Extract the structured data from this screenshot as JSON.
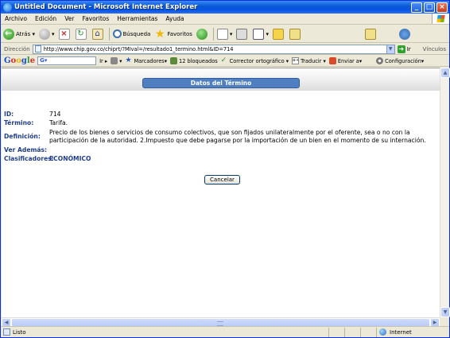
{
  "window": {
    "title": "Untitled Document - Microsoft Internet Explorer",
    "min": "_",
    "max": "□",
    "close": "×"
  },
  "menu": [
    "Archivo",
    "Edición",
    "Ver",
    "Favoritos",
    "Herramientas",
    "Ayuda"
  ],
  "toolbar": {
    "back": "Atrás",
    "search": "Búsqueda",
    "favorites": "Favoritos"
  },
  "address": {
    "label": "Dirección",
    "url": "http://www.chip.gov.co/chiprt/?MIval=/resultado1_termino.html&ID=714",
    "go": "Ir",
    "links": "Vínculos"
  },
  "google": {
    "search_prefix": "G▾",
    "go": "Ir ▸",
    "bookmarks": "Marcadores▾",
    "blocked": "12 bloqueados",
    "spell": "Corrector ortográfico ▾",
    "translate": "Traducir ▾",
    "send": "Enviar a▾",
    "settings": "Configuración▾"
  },
  "page": {
    "heading": "Datos del Término",
    "fields": [
      {
        "label": "ID:",
        "value": "714"
      },
      {
        "label": "Término:",
        "value": "Tarifa."
      },
      {
        "label": "Definición:",
        "value": "Precio de los bienes o servicios de consumo colectivos, que son fijados unilateralmente por el oferente, sea o no con la participación de la autoridad. 2.Impuesto que debe pagarse por la importación de un bien en el momento de su internación."
      },
      {
        "label": "Ver Además:",
        "value": ""
      },
      {
        "label": "Clasificadores:",
        "value": "ECONÓMICO"
      }
    ],
    "cancel": "Cancelar"
  },
  "status": {
    "text": "Listo",
    "zone": "Internet"
  }
}
